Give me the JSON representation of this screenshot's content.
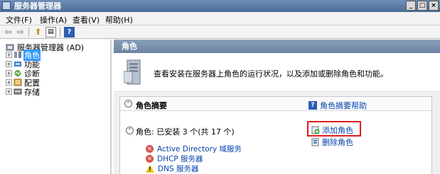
{
  "window": {
    "title": "服务器管理器"
  },
  "menu": [
    "文件(F)",
    "操作(A)",
    "查看(V)",
    "帮助(H)"
  ],
  "tree": {
    "root": "服务器管理器 (AD)",
    "items": [
      {
        "label": "角色",
        "selected": true
      },
      {
        "label": "功能"
      },
      {
        "label": "诊断"
      },
      {
        "label": "配置"
      },
      {
        "label": "存储"
      }
    ]
  },
  "main": {
    "header": "角色",
    "intro": "查看安装在服务器上角色的运行状况，以及添加或删除角色和功能。",
    "summary_title": "角色摘要",
    "help_link": "角色摘要帮助",
    "roles_line": "角色: 已安装 3 个(共 17 个)",
    "roles": [
      {
        "name": "Active Directory 域服务",
        "status": "error"
      },
      {
        "name": "DHCP 服务器",
        "status": "error"
      },
      {
        "name": "DNS 服务器",
        "status": "warning"
      }
    ],
    "actions": {
      "add": "添加角色",
      "remove": "删除角色"
    }
  }
}
